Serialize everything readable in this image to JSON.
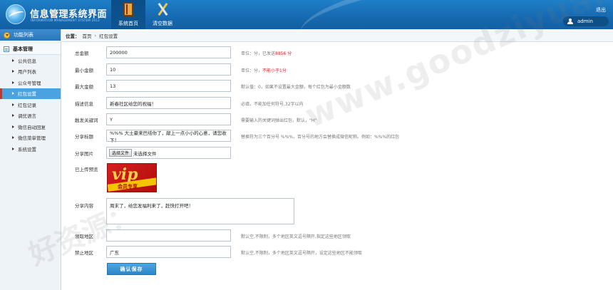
{
  "header": {
    "title": "信息管理系统界面",
    "subtitle": "INFORMATION MANAGEMENT SYSTEM 2012",
    "nav": [
      {
        "label": "系统首页",
        "icon": "book-icon"
      },
      {
        "label": "清空数据",
        "icon": "tools-icon"
      }
    ],
    "logout": "退出",
    "user": "admin"
  },
  "sidebar": {
    "head": "功能列表",
    "group": "基本管理",
    "items": [
      {
        "label": "公共信息"
      },
      {
        "label": "用户列表"
      },
      {
        "label": "公众号管理"
      },
      {
        "label": "红包设置"
      },
      {
        "label": "红包记录"
      },
      {
        "label": "调优语言"
      },
      {
        "label": "微信自动回复"
      },
      {
        "label": "微信菜单管理"
      },
      {
        "label": "系统设置"
      }
    ],
    "active_index": 3
  },
  "breadcrumb": {
    "label": "位置：",
    "items": [
      "首页",
      "红包设置"
    ],
    "separator": "›"
  },
  "form": {
    "total": {
      "label": "总金额",
      "value": "200000",
      "hint_pre": "单位：分，已发送",
      "hint_red": "8856 分"
    },
    "min": {
      "label": "最小金额",
      "value": "10",
      "hint_pre": "单位：分，",
      "hint_red": "不能小于1分"
    },
    "max": {
      "label": "最大金额",
      "value": "13",
      "hint": "默认值：0，如果不设置最大金额，每个红包为最小金额数"
    },
    "desc": {
      "label": "描述信息",
      "value": "新春社区给您的祝福！",
      "hint": "必填，不能加任何符号,32字以内"
    },
    "keyword": {
      "label": "触发关键词",
      "value": "Y",
      "hint": "需要输入的关键词弹出红包，默认，\"H\""
    },
    "share_title": {
      "label": "分享标题",
      "value": "%%% 大土豪来巴结你了，献上一点小小的心意，请您收下！",
      "hint": "替换符为三个百分号 %%%，百分号的地方会替换成微信昵称。例如：%%%的红包"
    },
    "share_image": {
      "label": "分享图片",
      "button": "选择文件",
      "file_status": "未选择文件"
    },
    "uploaded": {
      "label": "已上传预览",
      "img_text_main": "vip",
      "img_text_sub": "会员专享"
    },
    "share_content": {
      "label": "分享内容",
      "value": "周末了，给您发福利来了，赶快打开吧！"
    },
    "region": {
      "label": "领取地区",
      "value": "",
      "hint": "默认空,不限制，多个地区英文逗号隔开,指定这些地区领取"
    },
    "forbid": {
      "label": "禁止地区",
      "value": "广东",
      "hint": "默认空,不限制，多个地区英文逗号隔开，设定这些地区不能领取"
    },
    "save": "确认保存"
  },
  "watermark": {
    "line1": "www.goodziyuan.com",
    "line2": "好资源："
  }
}
